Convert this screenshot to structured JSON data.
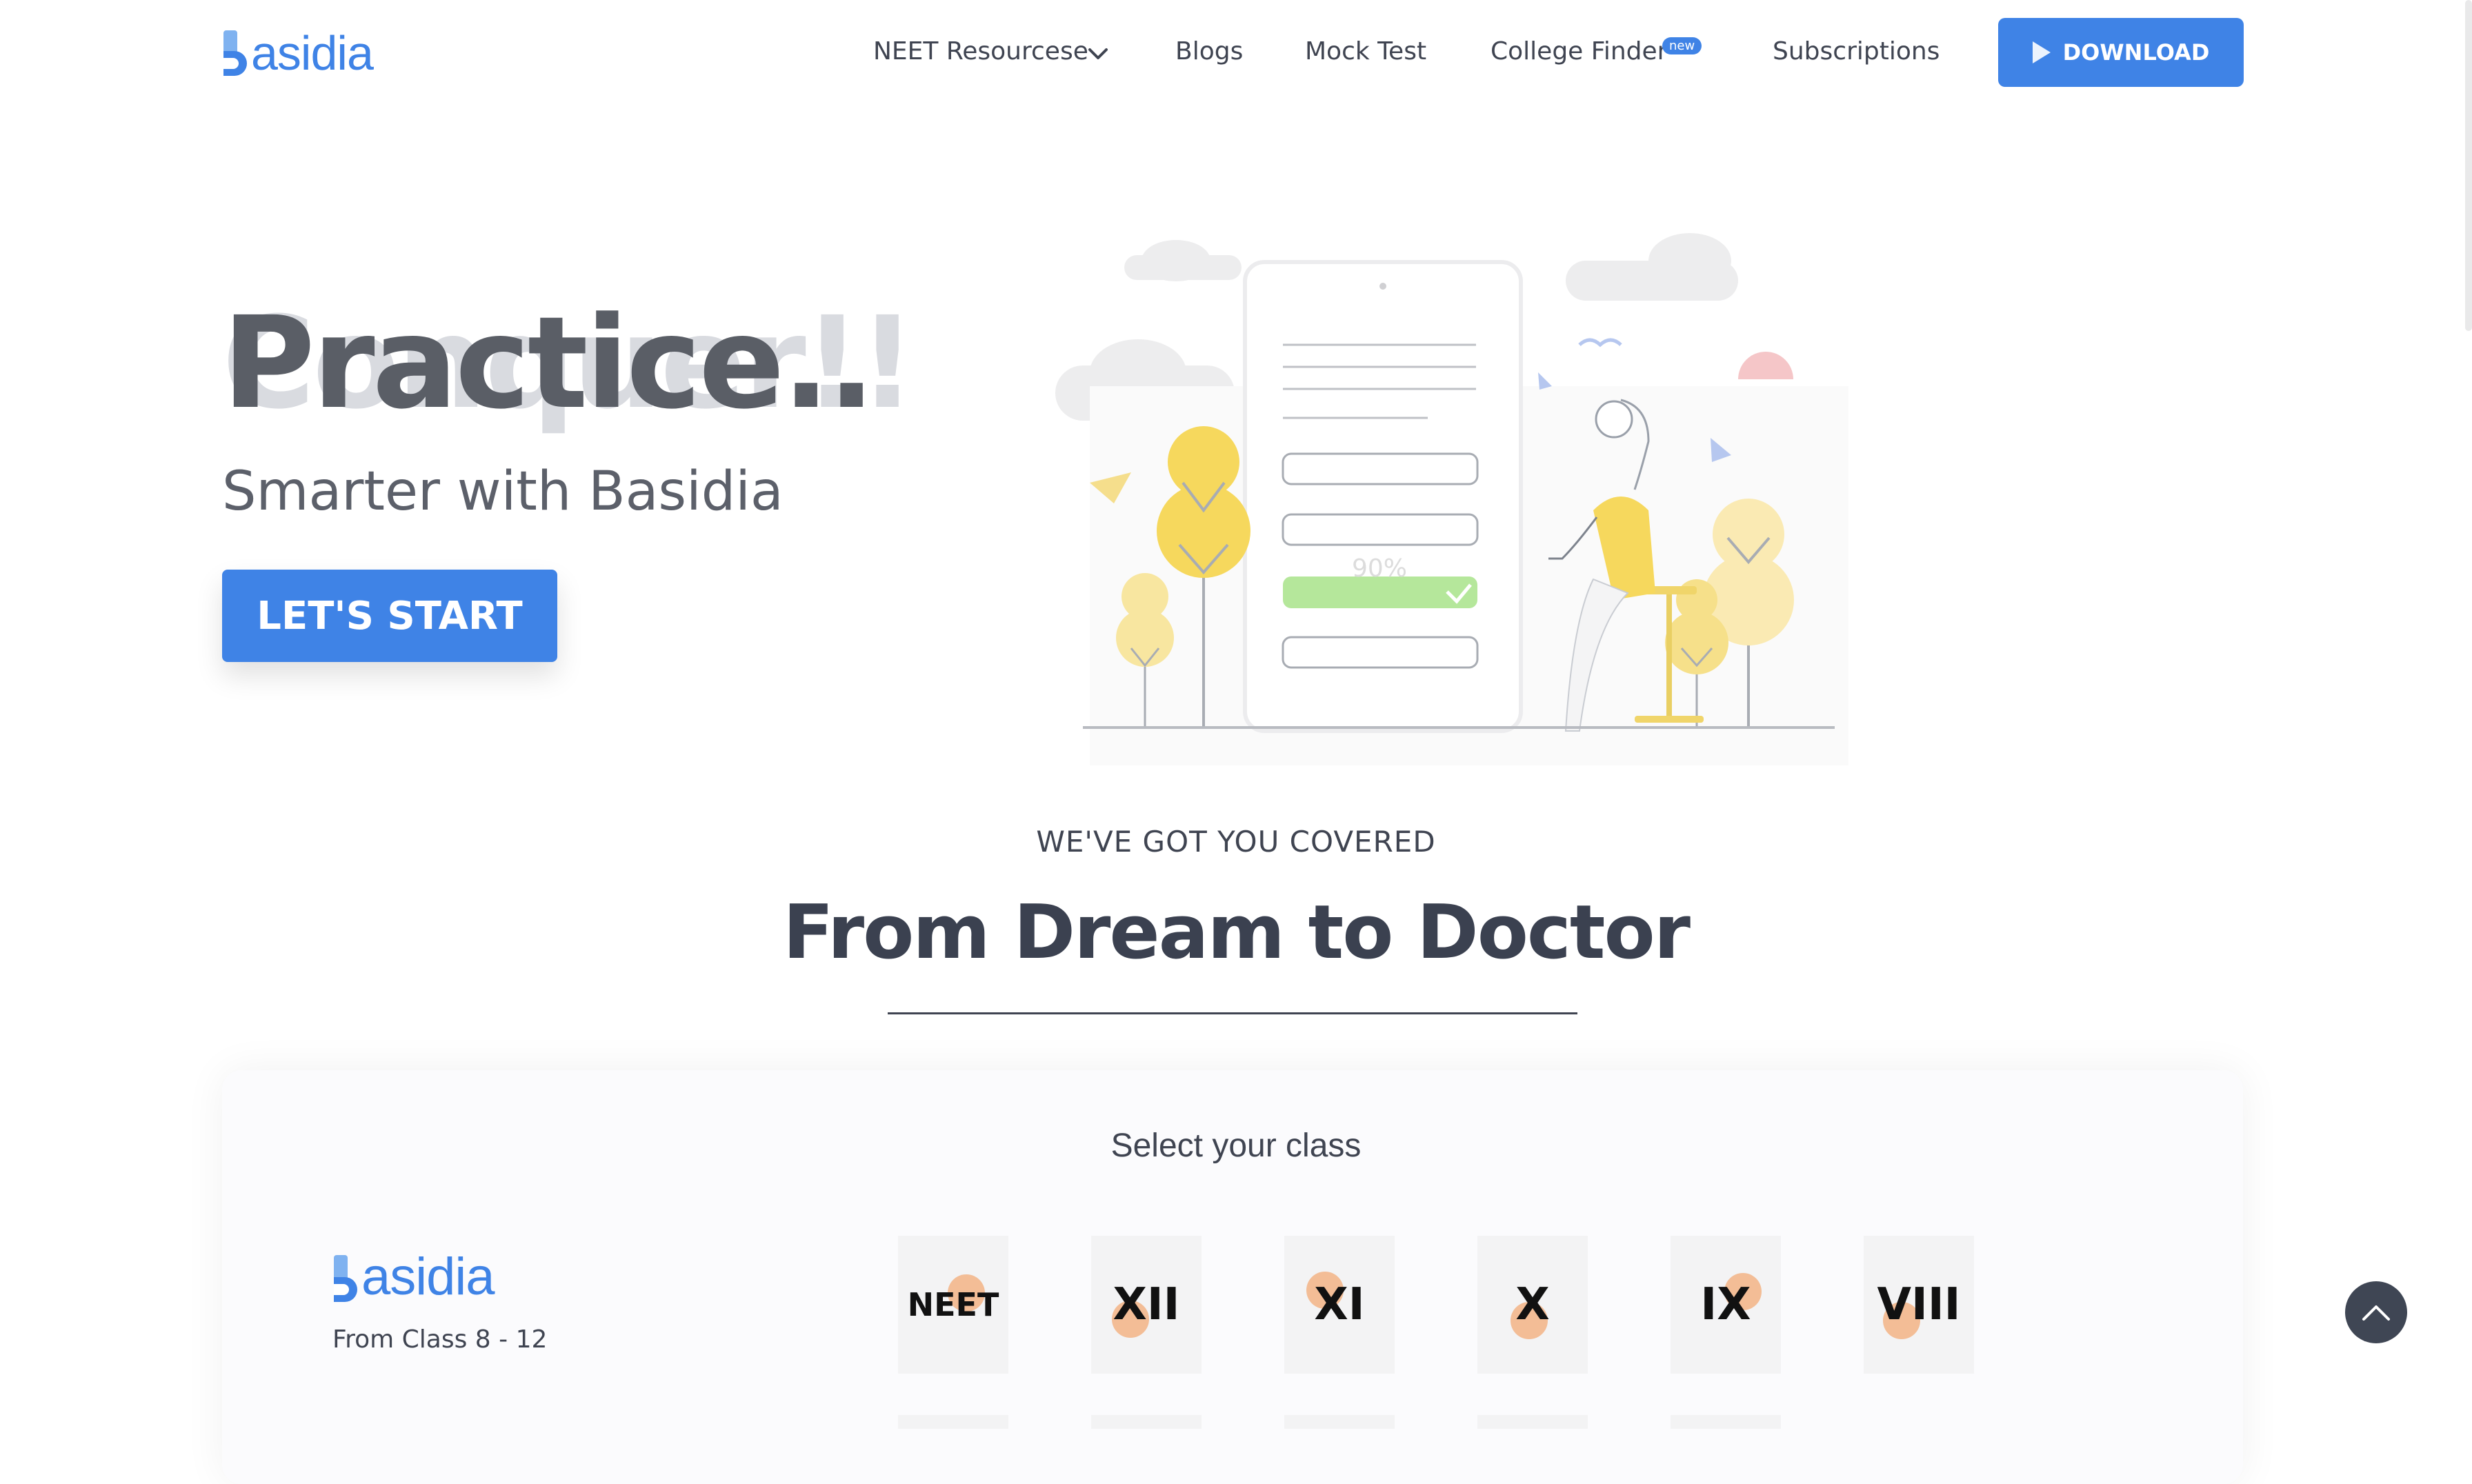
{
  "brand": {
    "name": "asidia",
    "accent": "#3f83e6"
  },
  "nav": {
    "items": [
      {
        "label": "NEET Resourcese",
        "has_dropdown": true
      },
      {
        "label": "Blogs"
      },
      {
        "label": "Mock Test"
      },
      {
        "label": "College Finder",
        "badge": "new"
      },
      {
        "label": "Subscriptions"
      }
    ],
    "download_label": "DOWNLOAD"
  },
  "hero": {
    "title": "Practice..",
    "title_ghost": "Conquer!!",
    "subtitle": "Smarter with Basidia",
    "subtitle_ghost": "Smarter with Basidia",
    "cta_label": "LET'S START",
    "illustration": {
      "score_text": "90%"
    }
  },
  "covered": {
    "eyebrow": "WE'VE GOT YOU COVERED",
    "heading": "From Dream to Doctor"
  },
  "classes": {
    "title": "Select your class",
    "logo_name": "asidia",
    "range_label": "From Class 8 - 12",
    "items": [
      "NEET",
      "XII",
      "XI",
      "X",
      "IX",
      "VIII"
    ]
  },
  "icons": {
    "dropdown": "chevron-down-icon",
    "download": "play-icon",
    "scroll_top": "chevron-up-icon"
  }
}
